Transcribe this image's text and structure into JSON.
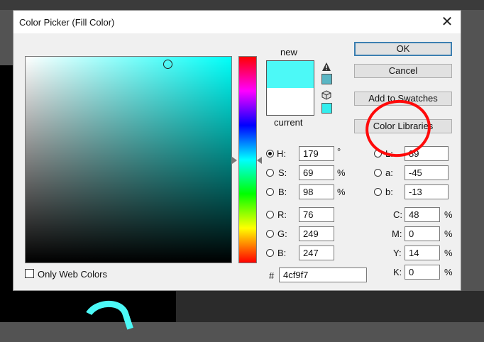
{
  "dialog": {
    "title": "Color Picker (Fill Color)",
    "close_glyph": "✕"
  },
  "preview": {
    "new_label": "new",
    "current_label": "current",
    "new_color": "#4cf9f7",
    "current_color": "#ffffff",
    "icons": [
      "out-of-gamut-warning-icon",
      "web-safe-cube-icon"
    ]
  },
  "buttons": {
    "ok": "OK",
    "cancel": "Cancel",
    "add_to_swatches": "Add to Swatches",
    "color_libraries": "Color Libraries"
  },
  "hsb": {
    "h": {
      "label": "H:",
      "value": "179",
      "unit": "°"
    },
    "s": {
      "label": "S:",
      "value": "69",
      "unit": "%"
    },
    "b": {
      "label": "B:",
      "value": "98",
      "unit": "%"
    }
  },
  "rgb": {
    "r": {
      "label": "R:",
      "value": "76"
    },
    "g": {
      "label": "G:",
      "value": "249"
    },
    "b": {
      "label": "B:",
      "value": "247"
    }
  },
  "lab": {
    "l": {
      "label": "L:",
      "value": "89"
    },
    "a": {
      "label": "a:",
      "value": "-45"
    },
    "b": {
      "label": "b:",
      "value": "-13"
    }
  },
  "cmyk": {
    "c": {
      "label": "C:",
      "value": "48",
      "unit": "%"
    },
    "m": {
      "label": "M:",
      "value": "0",
      "unit": "%"
    },
    "y": {
      "label": "Y:",
      "value": "14",
      "unit": "%"
    },
    "k": {
      "label": "K:",
      "value": "0",
      "unit": "%"
    }
  },
  "hex": {
    "label": "#",
    "value": "4cf9f7"
  },
  "only_web_colors": {
    "label": "Only Web Colors",
    "checked": false
  },
  "annotation": {
    "color": "#ff0a0a"
  }
}
